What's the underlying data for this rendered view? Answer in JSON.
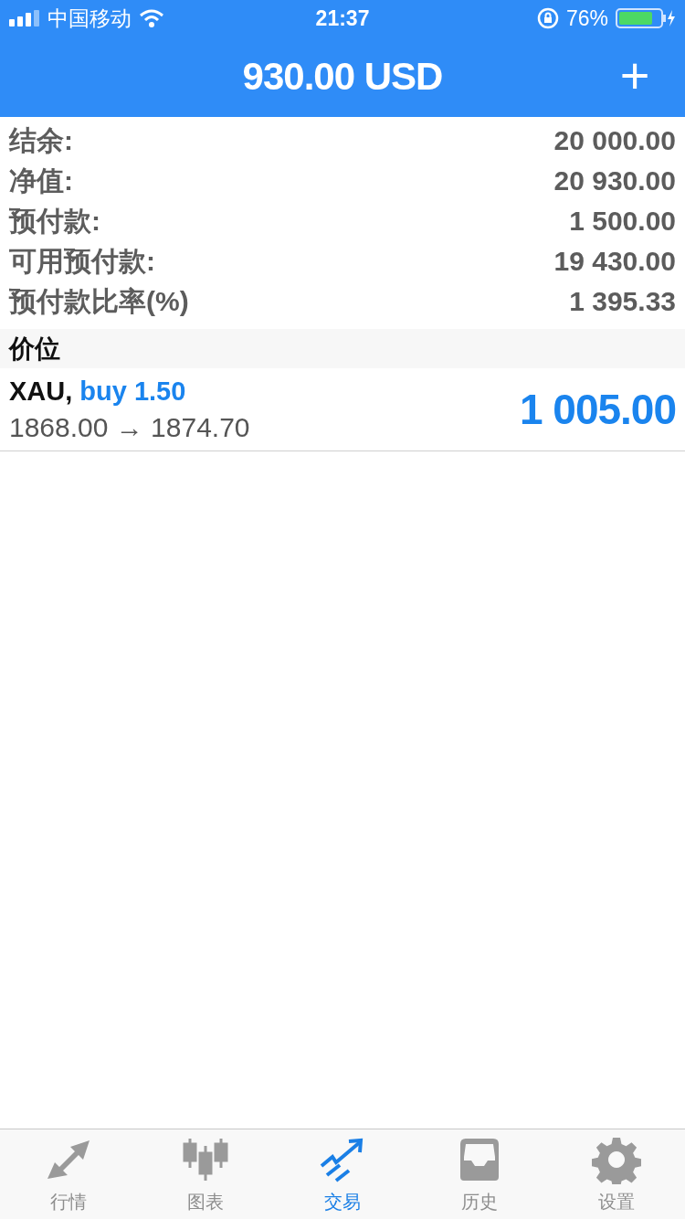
{
  "status_bar": {
    "carrier": "中国移动",
    "time": "21:37",
    "battery": "76%"
  },
  "header": {
    "title": "930.00 USD",
    "action": "+"
  },
  "summary": [
    {
      "label": "结余:",
      "value": "20 000.00"
    },
    {
      "label": "净值:",
      "value": "20 930.00"
    },
    {
      "label": "预付款:",
      "value": "1 500.00"
    },
    {
      "label": "可用预付款:",
      "value": "19 430.00"
    },
    {
      "label": "预付款比率(%)",
      "value": "1 395.33"
    }
  ],
  "section": {
    "title": "价位"
  },
  "positions": [
    {
      "symbol": "XAU,",
      "order": "buy 1.50",
      "prices": "1868.00 → 1874.70",
      "profit": "1 005.00"
    }
  ],
  "tabs": [
    {
      "kind": "quotes",
      "label": "行情",
      "selected": false
    },
    {
      "kind": "chart",
      "label": "图表",
      "selected": false
    },
    {
      "kind": "trade",
      "label": "交易",
      "selected": true
    },
    {
      "kind": "history",
      "label": "历史",
      "selected": false
    },
    {
      "kind": "settings",
      "label": "设置",
      "selected": false
    }
  ]
}
